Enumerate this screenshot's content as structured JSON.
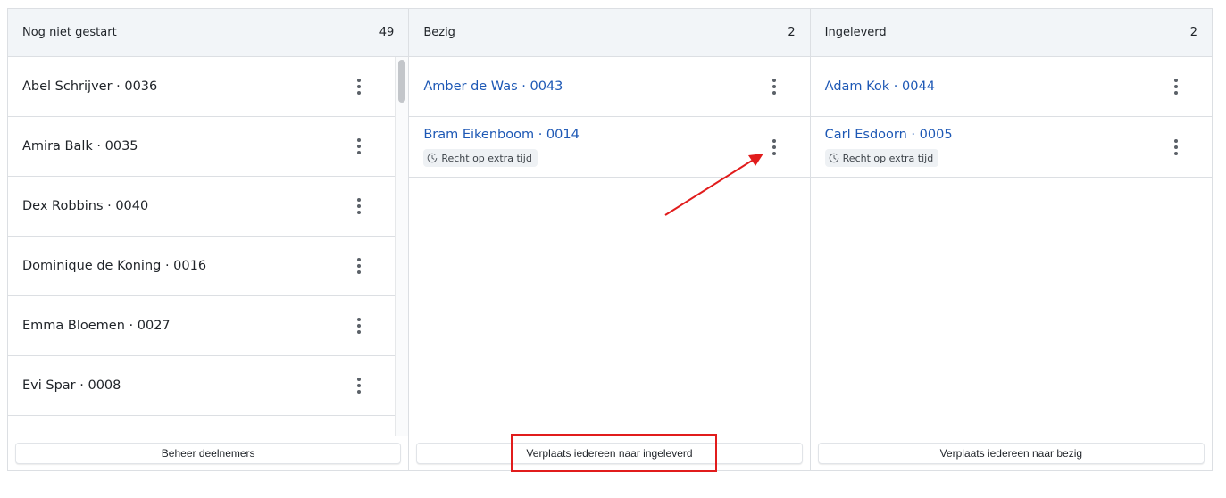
{
  "columns": [
    {
      "title": "Nog niet gestart",
      "count": "49",
      "cards": [
        {
          "name": "Abel Schrijver · 0036"
        },
        {
          "name": "Amira Balk · 0035"
        },
        {
          "name": "Dex Robbins · 0040"
        },
        {
          "name": "Dominique de Koning · 0016"
        },
        {
          "name": "Emma Bloemen · 0027"
        },
        {
          "name": "Evi Spar · 0008"
        }
      ],
      "footer_button": "Beheer deelnemers"
    },
    {
      "title": "Bezig",
      "count": "2",
      "cards": [
        {
          "name": "Amber de Was · 0043",
          "badge": ""
        },
        {
          "name": "Bram Eikenboom · 0014",
          "badge": "Recht op extra tijd"
        }
      ],
      "footer_button": "Verplaats iedereen naar ingeleverd"
    },
    {
      "title": "Ingeleverd",
      "count": "2",
      "cards": [
        {
          "name": "Adam Kok · 0044",
          "badge": ""
        },
        {
          "name": "Carl Esdoorn · 0005",
          "badge": "Recht op extra tijd"
        }
      ],
      "footer_button": "Verplaats iedereen naar bezig"
    }
  ],
  "icons": {
    "card_menu": "more-vertical-icon",
    "badge": "clock-icon"
  },
  "colors": {
    "link": "#1d58b5",
    "annotation": "#e11c1c",
    "header_bg": "#f2f5f8"
  }
}
